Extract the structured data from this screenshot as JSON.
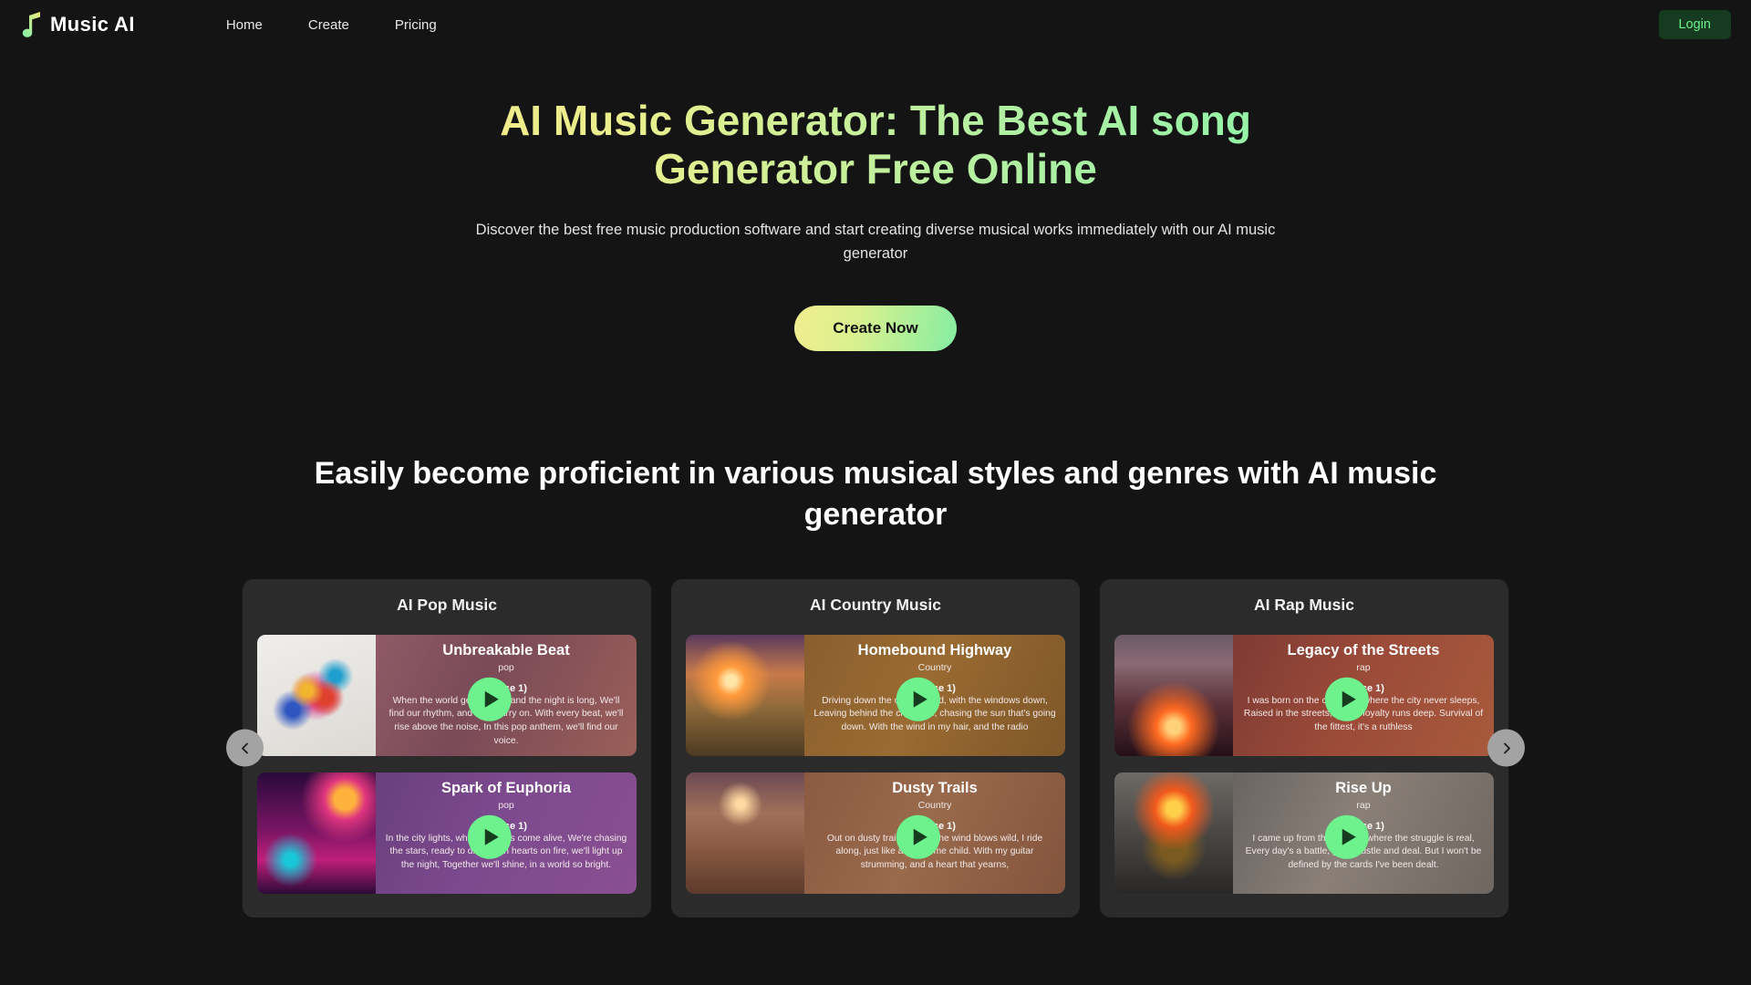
{
  "nav": {
    "logo_text": "Music AI",
    "links": [
      {
        "label": "Home"
      },
      {
        "label": "Create"
      },
      {
        "label": "Pricing"
      }
    ],
    "login_label": "Login"
  },
  "hero": {
    "title": "AI Music Generator: The Best AI song Generator Free Online",
    "subtitle": "Discover the best free music production software and start creating diverse musical works immediately with our AI music generator",
    "cta_label": "Create Now"
  },
  "section": {
    "heading": "Easily become proficient in various musical styles and genres with AI music generator",
    "prev_label": "‹",
    "next_label": "›"
  },
  "colors": {
    "page_bg": "#141414",
    "card_bg": "#2b2b2b",
    "accent_green": "#6df28e",
    "accent_yellow": "#f2ee8e",
    "login_bg": "#153b21",
    "login_text": "#6ef08a",
    "arrow_bg": "#a3a3a3"
  },
  "carousel": {
    "cards": [
      {
        "genre_title": "AI Pop Music",
        "songs": [
          {
            "title": "Unbreakable Beat",
            "genre": "pop",
            "verse": "(Verse 1)",
            "lyrics": "When the world gets heavy, and the night is long,\nWe'll find our rhythm, and we'll carry on.\nWith every beat, we'll rise above the noise,\nIn this pop anthem, we'll find our voice.",
            "art": "art-pop1",
            "bg": "bg-pop1"
          },
          {
            "title": "Spark of Euphoria",
            "genre": "pop",
            "verse": "(Verse 1)",
            "lyrics": "In the city lights, where dreams come alive,\nWe're chasing the stars, ready to dive.\nWith hearts on fire, we'll light up the night,\nTogether we'll shine, in a world so bright.",
            "art": "art-pop2",
            "bg": "bg-pop2"
          }
        ]
      },
      {
        "genre_title": "AI Country Music",
        "songs": [
          {
            "title": "Homebound Highway",
            "genre": "Country",
            "verse": "(Verse 1)",
            "lyrics": "Driving down the old dirt road, with the windows down,\nLeaving behind the city lights, chasing the sun that's going down.\nWith the wind in my hair, and the radio",
            "art": "art-cty1",
            "bg": "bg-cty1"
          },
          {
            "title": "Dusty Trails",
            "genre": "Country",
            "verse": "(Verse 1)",
            "lyrics": "Out on dusty trails, where the wind blows wild,\nI ride along, just like a lonesome child.\nWith my guitar strumming, and a heart that yearns,",
            "art": "art-cty2",
            "bg": "bg-cty2"
          }
        ]
      },
      {
        "genre_title": "AI Rap Music",
        "songs": [
          {
            "title": "Legacy of the Streets",
            "genre": "rap",
            "verse": "(Verse 1)",
            "lyrics": "I was born on the concrete, where the city never sleeps,\nRaised in the streets, where loyalty runs deep.\nSurvival of the fittest, it's a ruthless",
            "art": "art-rap1",
            "bg": "bg-rap1"
          },
          {
            "title": "Rise Up",
            "genre": "rap",
            "verse": "(Verse 1)",
            "lyrics": "I came up from the streets, where the struggle is real,\nEvery day's a battle, gotta hustle and deal.\nBut I won't be defined by the cards I've been dealt.",
            "art": "art-rap2",
            "bg": "bg-rap2"
          }
        ]
      }
    ]
  }
}
